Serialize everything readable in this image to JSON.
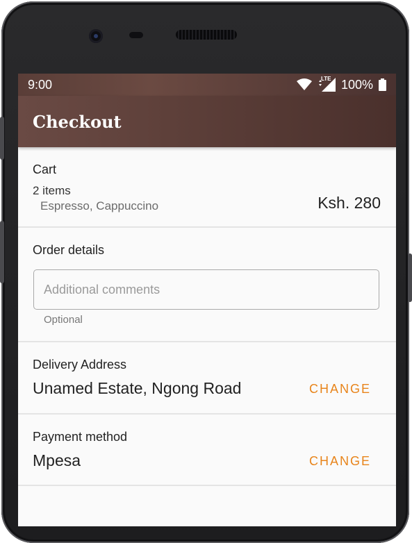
{
  "status_bar": {
    "time": "9:00",
    "network_type": "LTE",
    "battery": "100%",
    "icons": [
      "wifi-icon",
      "signal-icon",
      "battery-icon"
    ]
  },
  "app_bar": {
    "title": "Checkout"
  },
  "cart": {
    "label": "Cart",
    "count": "2 items",
    "items": "Espresso, Cappuccino",
    "total": "Ksh. 280"
  },
  "order_details": {
    "label": "Order details",
    "comments_placeholder": "Additional comments",
    "comments_value": "",
    "helper": "Optional"
  },
  "delivery": {
    "label": "Delivery Address",
    "value": "Unamed Estate, Ngong Road",
    "action": "CHANGE"
  },
  "payment": {
    "label": "Payment method",
    "value": "Mpesa",
    "action": "CHANGE"
  },
  "colors": {
    "app_bar": "#5e403a",
    "accent": "#e8841a"
  }
}
